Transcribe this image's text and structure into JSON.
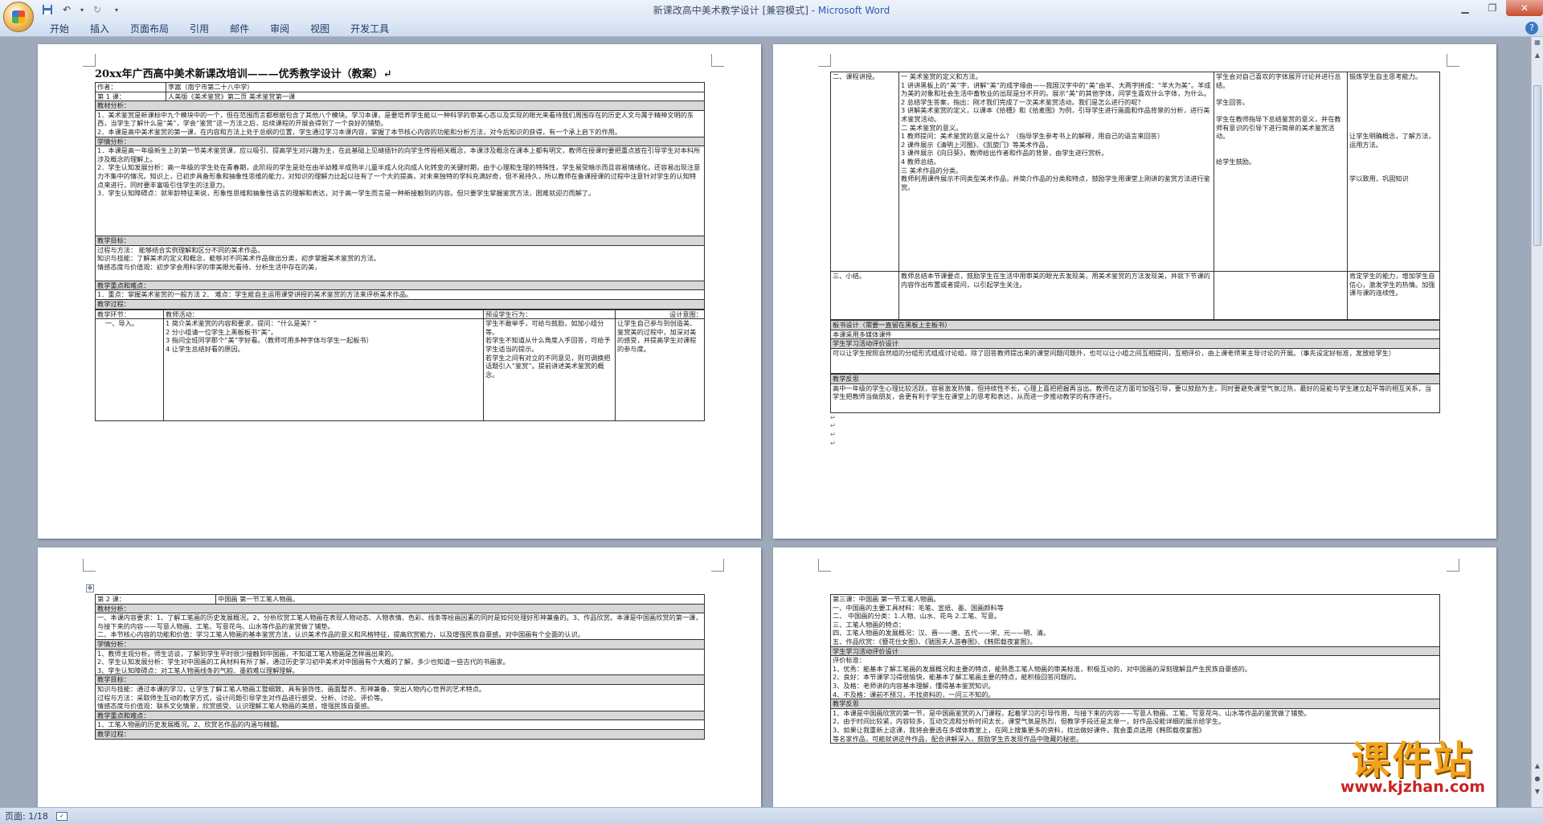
{
  "window": {
    "title_doc": "新课改高中美术教学设计 [兼容模式] - ",
    "title_app": "Microsoft Word"
  },
  "ribbon": {
    "tabs": [
      "开始",
      "插入",
      "页面布局",
      "引用",
      "邮件",
      "审阅",
      "视图",
      "开发工具"
    ]
  },
  "status": {
    "page": "页面: 1/18"
  },
  "page1": {
    "title": "20xx年广西高中美术新课改培训———优秀教学设计（教案）↵",
    "author_label": "作者：",
    "author_value": "李嵩（南宁市第二十八中学）",
    "lesson_label": "第 1 课：",
    "lesson_value": "人美版《美术鉴赏》第二页  美术鉴赏第一课",
    "sec1": "教材分析：",
    "sec1_p1": "1．美术鉴赏是新课标中九个模块中的一个，但在范围而言都根据包含了其他八个模块。学习本课，是要培养学生能以一种科学的审美心态以及实现的眼光来看待我们周围存在的历史人文与属于精神文明的东西，当学生了解什么是“美”，学会“鉴赏”这一方法之后，后续课程的开展会得到了一个良好的铺垫。",
    "sec1_p2": "2．本课是高中美术鉴赏的第一课，在内容和方法上处于总纲的位置，学生通过学习本课内容，掌握了本节核心内容的功能和分析方法，对今后知识的获得，有一个承上启下的作用。",
    "sec2": "学情分析：",
    "sec2_p1": "1．本课是高一年级新生上的第一节美术鉴赏课，应以吸引、提高学生对兴趣为主，在此基础上见缝插针的向学生传授相关概念，本课涉及概念在课本上都有明文，教师在授课时要把重点放在引导学生对本科所涉及概念的理解上。",
    "sec2_p2": "2．学生认知发展分析：高一年级的学生处在青春期，此阶段的学生是处在由半幼稚半成熟半儿童半成人化向成人化转变的关键时期，由于心理和生理的特殊性，学生易受暗示而且容易情绪化，还容易出现注意力不集中的情况。知识上，已初步具备形象和抽象性思维的能力，对知识的理解力比起以往有了一个大的提高，对未来独特的学科充满好奇，但不易持久，所以教师在备课授课的过程中注意针对学生的认知特点来进行，同时要丰富吸引住学生的注意力。",
    "sec2_p3": "3．学生认知障碍点：就年龄特征来说，形象性思维和抽象性语言的理解和表达，对于高一学生而言是一种新接触到的内容。但只要学生掌握鉴赏方法，困难就迎刃而解了。",
    "sec3": "教学目标：",
    "sec3_p1": "过程与方法：  能够结合实例理解和区分不同的美术作品，",
    "sec3_p2": "知识与技能：了解美术的定义和概念，能够对不同美术作品做出分类，初步掌握美术鉴赏的方法。",
    "sec3_p3": "情感态度与价值观：初步学会用科学的审美眼光看待、分析生活中存在的美，",
    "sec4": "教学重点和难点：",
    "sec4_p1": "1．重点：掌握美术鉴赏的一般方法 2．      难点：学生能自主运用课堂讲授的美术鉴赏的方法来评析美术作品。",
    "sec5": "教学过程：",
    "proc_h1": "教学环节：",
    "proc_h2": "教师活动：",
    "proc_h3": "预设学生行为：",
    "proc_h4": "设计意图：",
    "step1": "一、导入。",
    "step1_teacher": "1 简介美术鉴赏的内容和要求，提问：“什么是美？”\n2 分小组请一位学生上黑板板书“美”。\n3 指问全班同学那个“美”字好看。（教师可用多种字体与学生一起板书）\n4 让学生总结好看的原因。",
    "step1_student": "学生不敢举手，可给与鼓励，如加小组分等。\n若学生不知道从什么角度入手回答，可给予学生适当的提示。\n若学生之间有对立的不同意见，则可调换把话题引入“鉴赏”。提前讲述美术鉴赏的概念。",
    "step1_design": "让学生自己参与到创造美、鉴赏美的过程中，加深对美的感受，并提高学生对课程的参与度。"
  },
  "page2": {
    "step2": "二、课程讲授。",
    "step2_teacher": "一  美术鉴赏的定义和方法。\n1 讲讲黑板上的“美”字，讲解“美”的成字缘由——我国汉字中的“美”由羊、大两字拼成：“羊大为美”。羊成为美的对象和社会生活中畜牧业的出现是分不开的。展示“美”的其他字体，问学生喜欢什么字体，为什么。\n2 总结学生答案，指出：刚才我们完成了一次美术鉴赏活动。我们是怎么进行的呢？\n3 讲解美术鉴赏的定义，以课本《拾穗》和《拾麦图》为例，引导学生进行画面和作品背景的分析，进行美术鉴赏活动。\n二 美术鉴赏的意义。\n1 教师提问：美术鉴赏的意义是什么？（指导学生参考书上的解释，用自己的语言来回答）\n2 课件展示《清明上河图》、《凯旋门》等美术作品，\n3 课件展示《向日葵》，教师给出作者和作品的背景，由学生进行赏析。\n4 教师总结。\n三 美术作品的分类。\n教师利用课件展示不同类型美术作品，并简介作品的分类和特点，鼓励学生用课堂上刚讲的鉴赏方法进行鉴赏。",
    "step2_student": "学生会对自己喜欢的字体展开讨论并进行总结。\n\n学生回答。\n\n学生在教师指导下总结鉴赏的意义，并在教师有意识的引导下进行简单的美术鉴赏活动。\n\n\n给学生鼓励。",
    "step2_design": "锻炼学生自主思考能力。\n\n\n\n\n\n\n让学生明确概念，了解方法，运用方法。\n\n\n\n学以致用，巩固知识",
    "step3": "三、小结。",
    "step3_teacher": "教师总结本节课要点，鼓励学生在生活中用审美的眼光去发现美，用美术鉴赏的方法发现美，并就下节课的内容作出布置或者提问，以引起学生关注。",
    "step3_design": "肯定学生的能力，增加学生自信心，激发学生的热情。加强课与课的连续性。",
    "sec_board": "板书设计（需要一直留在黑板上主板书）",
    "board_p": "  本课采用多媒体课件",
    "sec_eval": "学生学习活动评价设计",
    "eval_p": "可以让学生按照自然组的分组形式组成讨论组，除了回答教师提出来的课堂问题问题外，也可以让小组之间互相提问，互相评价，由上课老师来主导讨论的开展。（事先设定好标准，发放给学生）",
    "sec_reflect": "教学反思",
    "reflect_p": "高中一年级的学生心理比较活跃，容易激发热情，但持续性不长，心理上喜把把握再当出。教师在这方面可加强引导，要以鼓励为主，同时要避免课堂气氛过热，最好的是能与学生建立起平等的相互关系，当学生把教师当做朋友，会更有利于学生在课堂上的思考和表达，从而进一步推动教学的有序进行。"
  },
  "page3": {
    "lesson_label": "第 2 课：",
    "lesson_value": "中国画       第一节工笔人物画。",
    "sec1": "教材分析：",
    "sec1_p1": "一、本课内容要求：1、了解工笔画的历史发展概况。2、分析欣赏工笔人物画在表现人物动态、人物表情、色彩、线条等绘画因素的同时是如何处理好形神兼备的。3、作品欣赏。本课是中国画欣赏的第一课，与接下来的内容——写意人物画、工笔、写意花鸟、山水等作品的鉴赏做了铺垫。",
    "sec1_p2": "二、本节核心内容的功能和价值：学习工笔人物画的基本鉴赏方法，认识美术作品的意义和风格特征，提高欣赏能力，以及增强民族自豪感。对中国画有个全面的认识。",
    "sec2": "学情分析：",
    "sec2_p1": "1、教师主观分析。师生访谈，了解到学生平时很少接触到中国画，不知道工笔人物画是怎样画出来的。",
    "sec2_p2": "2、学生认知发展分析：学生对中国画的工具材料有所了解，通过历史学习初中美术对中国画有个大概的了解，多少也知道一些古代的书画家。",
    "sec2_p3": "3、学生认知障碍点：对工笔人物画线条的气韵、墨韵难以理解理解。",
    "sec3": "教学目标：",
    "sec3_p1": "知识与技能：通过本课的学习，让学生了解工笔人物画工整细致、具有装饰性、画面整齐、形神兼备、突出人物内心世界的艺术特点。",
    "sec3_p2": "过程与方法：采取师生互动的教学方式，设计问题引导学生对作品进行感受、分析、讨论、评价等。",
    "sec3_p3": "情感态度与价值观：联系文化情景，欣赏感受、认识理解工笔人物画的美感，增强民族自豪感。",
    "sec4": "教学重点和难点：",
    "sec4_p1": "  1、工笔人物画的历史发展概况。2、欣赏名作品的内涵与精髓。",
    "sec5": "教学过程："
  },
  "page4": {
    "lesson_value": "第三课：中国画       第一节工笔人物画。",
    "p1": "一、中国画的主要工具材料：毛笔、宣纸、墨、国画颜料等",
    "p2": "二、    中国画的分类：1.人物、山水、花鸟      2.工笔、写意。",
    "p3": "三、工笔人物画的特点：",
    "p4": "四、工笔人物画的发展概况：汉、晋——唐、五代——宋、元——明、清。",
    "p5": "五、作品欣赏：《簪花仕女图》、《虢国夫人游春图》、《韩熙载夜宴图》。",
    "sec_eval": "学生学习活动评价设计",
    "eval_title": "评价标准：",
    "eval_1": "1、优秀：能基本了解工笔画的发展概况和主要的特点，能熟悉工笔人物画的审美标准，积极互动的，对中国画的深刻理解且产生民族自豪感的。",
    "eval_2": "2、良好：本节课学习得很愉快，能基本了解工笔画主要的特点，能积极回答问题的。",
    "eval_3": "3、及格：老师讲的内容基本理解，懂得基本鉴赏知识。",
    "eval_4": "4、不及格：课前不预习，不找资料的，一问三不知的。",
    "sec_reflect": "教学反思",
    "ref_1": "1、本课是中国画欣赏的第一节，是中国画鉴赏的入门课程，起着学习的引导作用，与接下来的内容——写意人物画、工笔、写意花鸟、山水等作品的鉴赏做了铺垫。",
    "ref_2": "2、由于时间比较紧，内容较多，互动交流和分析时间太长，课堂气氛是热烈，但教学手段还是太单一，好作品没能详细的展示给学生。",
    "ref_3": "3、如果让我重新上这课，我将会要选在多媒体教室上，在网上搜集更多的资料，找出做好课件，我会重点选用《韩熙载夜宴图》",
    "ref_4": "等名家作品，可能就讲这件作品，配合讲解深入，鼓励学生去发现作品中隐藏的秘密。"
  },
  "watermark": {
    "cn": "课件站",
    "url": "www.kjzhan.com"
  }
}
